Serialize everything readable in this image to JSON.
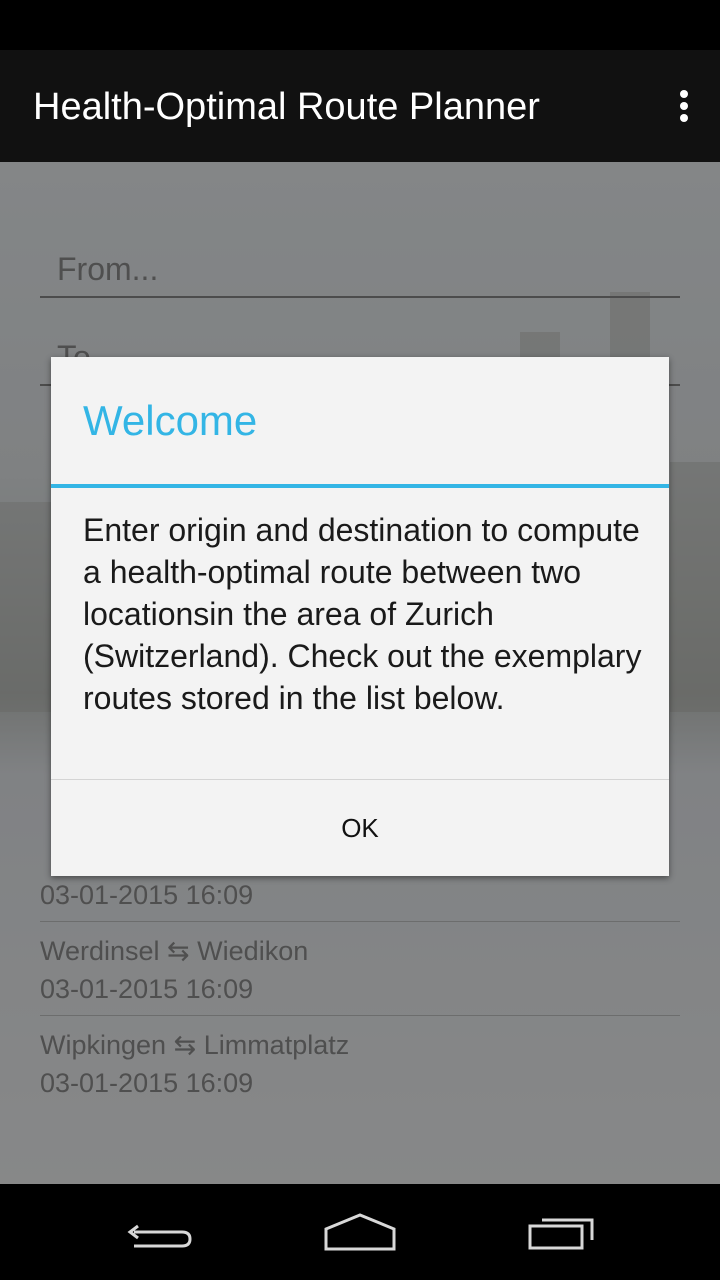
{
  "app": {
    "title": "Health-Optimal Route Planner",
    "overflow_icon": "overflow-menu-icon"
  },
  "form": {
    "from_placeholder": "From...",
    "to_placeholder": "To..."
  },
  "routes": [
    {
      "names": "Werdinsel ⇆ Wiedikon",
      "date": "03-01-2015 16:09"
    },
    {
      "names": "Wipkingen ⇆ Limmatplatz",
      "date": "03-01-2015 16:09"
    }
  ],
  "partial_route_date": "03-01-2015 16:09",
  "dialog": {
    "title": "Welcome",
    "message": "Enter origin and destination to compute a health-optimal route between two locationsin the area of Zurich (Switzerland). Check out the exemplary routes stored in the list below.",
    "ok_label": "OK"
  },
  "colors": {
    "accent": "#33b5e5",
    "action_bar": "#111111",
    "dialog_bg": "#f3f3f3"
  },
  "nav": {
    "back_icon": "back-icon",
    "home_icon": "home-icon",
    "recents_icon": "recent-apps-icon"
  }
}
